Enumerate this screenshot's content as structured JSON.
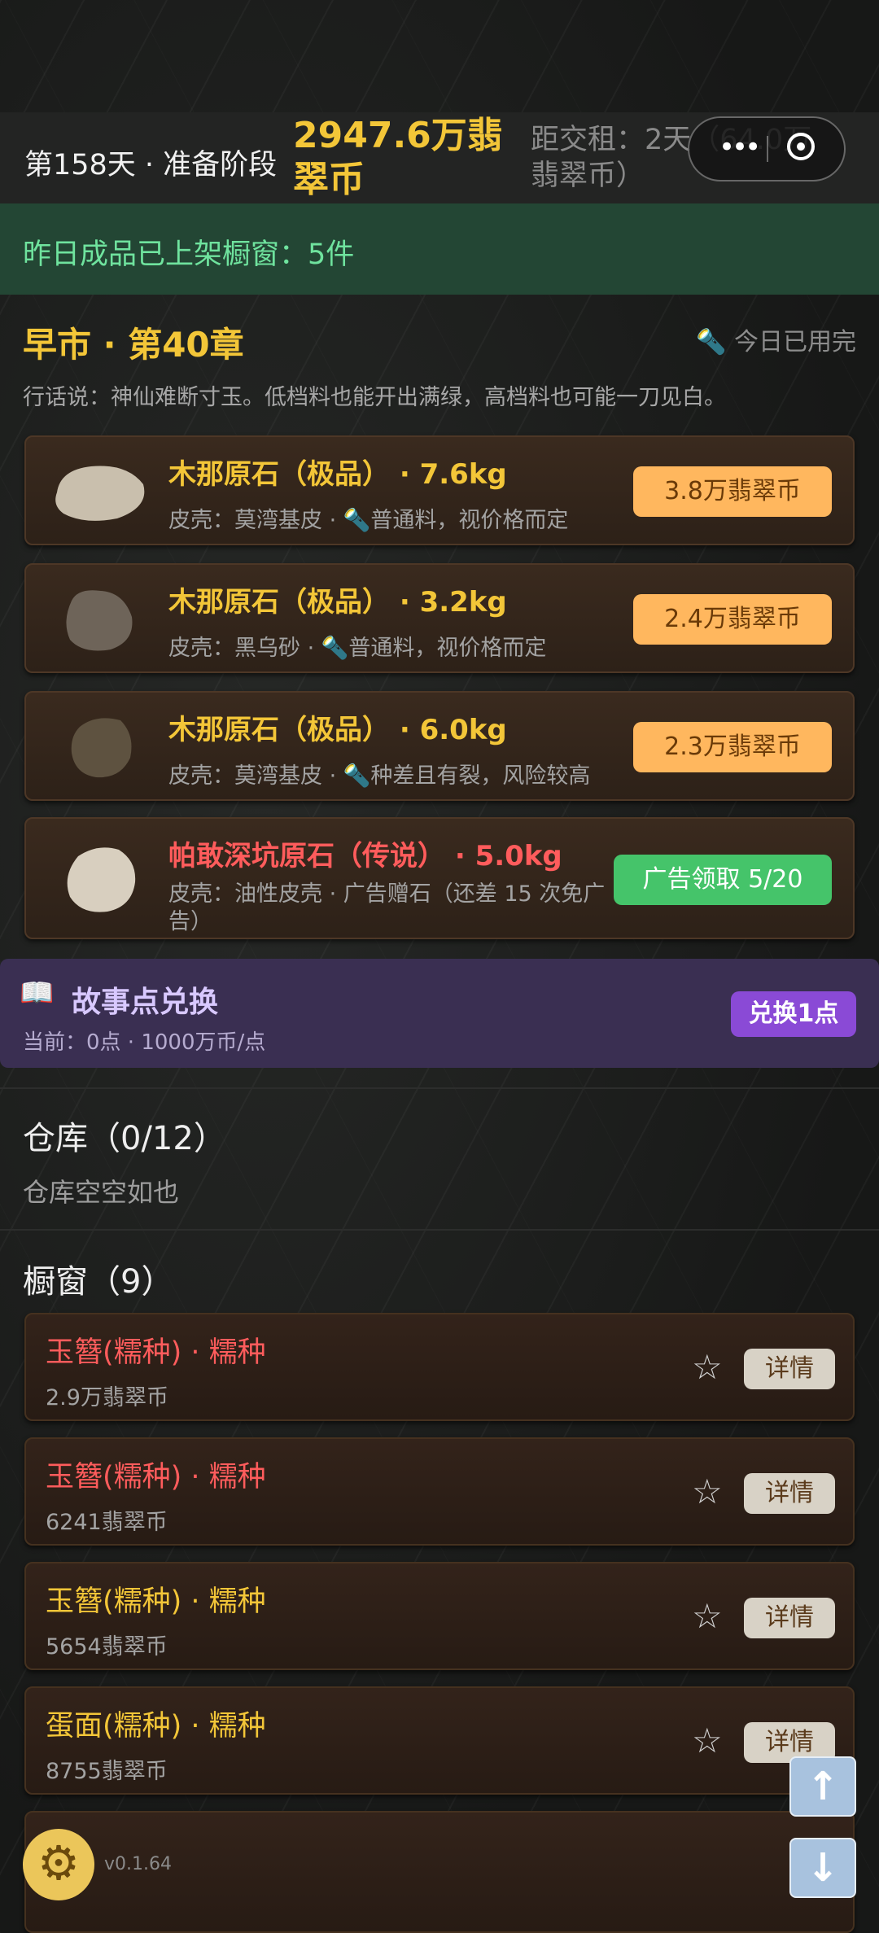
{
  "header": {
    "day": "第158天 · 准备阶段",
    "money": "2947.6万翡翠币",
    "rent": "距交租：2天（64.0万翡翠币）"
  },
  "notice": "昨日成品已上架橱窗：5件",
  "market": {
    "title": "早市 · 第40章",
    "torch_status": "今日已用完",
    "proverb": "行话说：神仙难断寸玉。低档料也能开出满绿，高档料也可能一刀见白。",
    "stones": [
      {
        "name": "木那原石（极品） · 7.6kg",
        "desc": "皮壳：莫湾基皮 · 🔦普通料，视价格而定",
        "price": "3.8万翡翠币",
        "color": "#c9bfad"
      },
      {
        "name": "木那原石（极品） · 3.2kg",
        "desc": "皮壳：黑乌砂 · 🔦普通料，视价格而定",
        "price": "2.4万翡翠币",
        "color": "#6e6459"
      },
      {
        "name": "木那原石（极品） · 6.0kg",
        "desc": "皮壳：莫湾基皮 · 🔦种差且有裂，风险较高",
        "price": "2.3万翡翠币",
        "color": "#5e5240"
      },
      {
        "name": "帕敢深坑原石（传说） · 5.0kg",
        "desc": "皮壳：油性皮壳 · 广告赠石（还差 15 次免广告）",
        "price": "广告领取 5/20",
        "color": "#d8cfbf"
      }
    ]
  },
  "story": {
    "title": "故事点兑换",
    "current": "当前：0点 · 1000万币/点",
    "button": "兑换1点"
  },
  "warehouse": {
    "title": "仓库（0/12）",
    "empty": "仓库空空如也"
  },
  "showcase": {
    "title": "橱窗（9）",
    "detail_label": "详情",
    "items": [
      {
        "name": "玉簪(糯种) · 糯种",
        "price": "2.9万翡翠币"
      },
      {
        "name": "玉簪(糯种) · 糯种",
        "price": "6241翡翠币"
      },
      {
        "name": "玉簪(糯种) · 糯种",
        "price": "5654翡翠币"
      },
      {
        "name": "蛋面(糯种) · 糯种",
        "price": "8755翡翠币"
      }
    ]
  },
  "footer": {
    "version": "v0.1.64"
  }
}
